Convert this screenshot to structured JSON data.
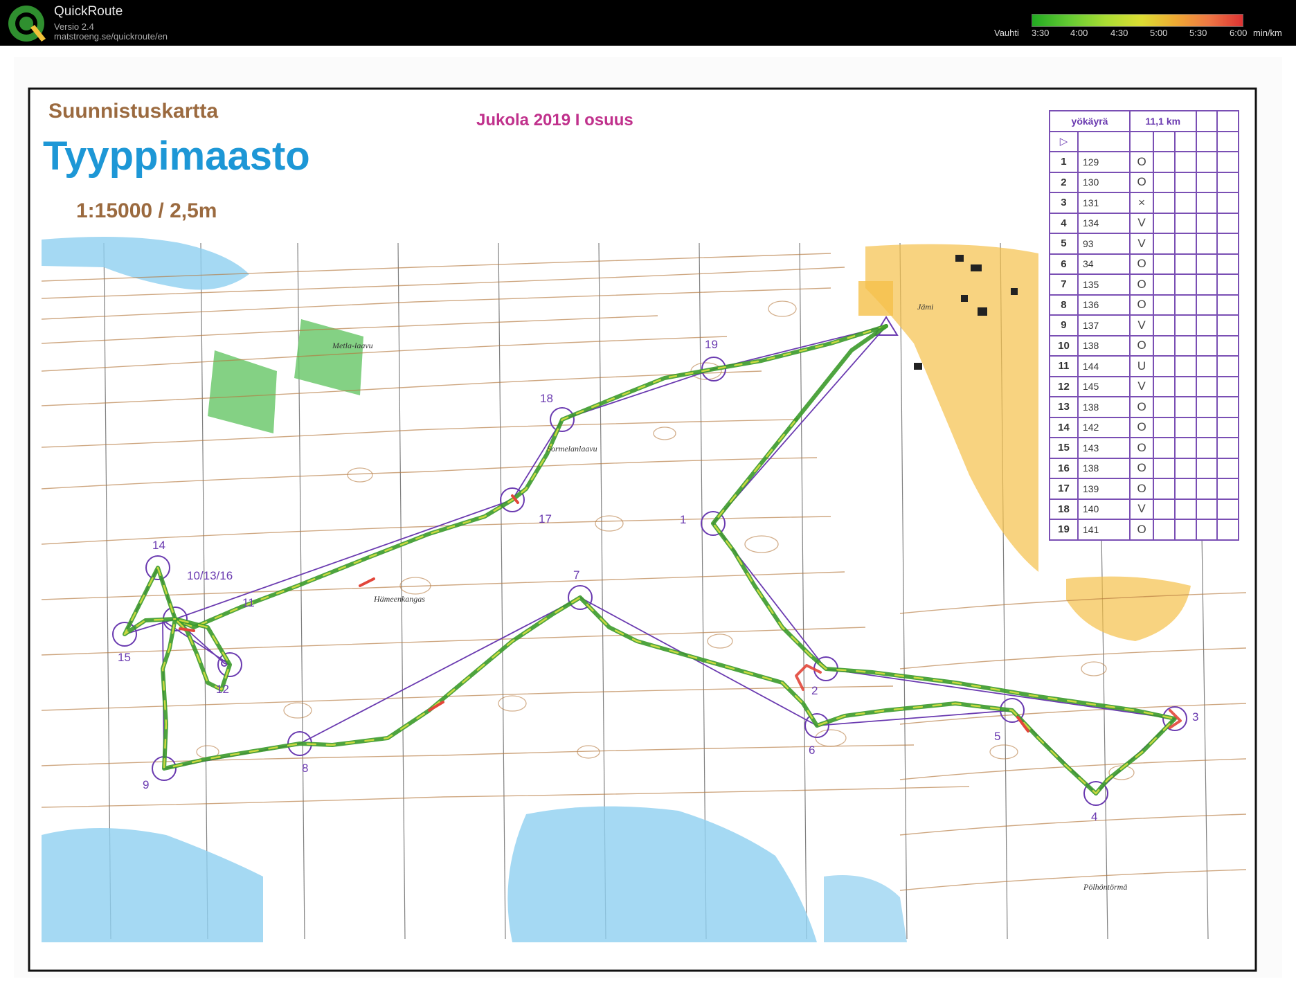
{
  "app": {
    "name": "QuickRoute",
    "version": "Versio 2.4",
    "url": "matstroeng.se/quickroute/en"
  },
  "pace_scale": {
    "label": "Vauhti",
    "ticks": [
      "3:30",
      "4:00",
      "4:30",
      "5:00",
      "5:30",
      "6:00"
    ],
    "unit": "min/km"
  },
  "map": {
    "title_small": "Suunnistuskartta",
    "title_big": "Tyyppimaasto",
    "scale_text": "1:15000 / 2,5m",
    "event": "Jukola 2019 I osuus",
    "places": [
      "Metla-laavu",
      "Sormelanlaavu",
      "Hämeenkangas",
      "Jämi",
      "Pölhöntörmä"
    ]
  },
  "controls": [
    {
      "label": "1"
    },
    {
      "label": "2"
    },
    {
      "label": "3"
    },
    {
      "label": "4"
    },
    {
      "label": "5"
    },
    {
      "label": "6"
    },
    {
      "label": "7"
    },
    {
      "label": "8"
    },
    {
      "label": "9"
    },
    {
      "label": "10/13/16"
    },
    {
      "label": "11"
    },
    {
      "label": "12"
    },
    {
      "label": "14"
    },
    {
      "label": "15"
    },
    {
      "label": "17"
    },
    {
      "label": "18"
    },
    {
      "label": "19"
    }
  ],
  "descriptions": {
    "class_name": "yökäyrä",
    "length": "11,1 km",
    "start_symbol": "▷",
    "rows": [
      {
        "num": "1",
        "code": "129",
        "sym": "O"
      },
      {
        "num": "2",
        "code": "130",
        "sym": "O"
      },
      {
        "num": "3",
        "code": "131",
        "sym": "×"
      },
      {
        "num": "4",
        "code": "134",
        "sym": "V"
      },
      {
        "num": "5",
        "code": "93",
        "sym": "V"
      },
      {
        "num": "6",
        "code": "34",
        "sym": "O"
      },
      {
        "num": "7",
        "code": "135",
        "sym": "O"
      },
      {
        "num": "8",
        "code": "136",
        "sym": "O"
      },
      {
        "num": "9",
        "code": "137",
        "sym": "V"
      },
      {
        "num": "10",
        "code": "138",
        "sym": "O"
      },
      {
        "num": "11",
        "code": "144",
        "sym": "U"
      },
      {
        "num": "12",
        "code": "145",
        "sym": "V"
      },
      {
        "num": "13",
        "code": "138",
        "sym": "O"
      },
      {
        "num": "14",
        "code": "142",
        "sym": "O"
      },
      {
        "num": "15",
        "code": "143",
        "sym": "O"
      },
      {
        "num": "16",
        "code": "138",
        "sym": "O"
      },
      {
        "num": "17",
        "code": "139",
        "sym": "O"
      },
      {
        "num": "18",
        "code": "140",
        "sym": "V"
      },
      {
        "num": "19",
        "code": "141",
        "sym": "O"
      }
    ]
  }
}
